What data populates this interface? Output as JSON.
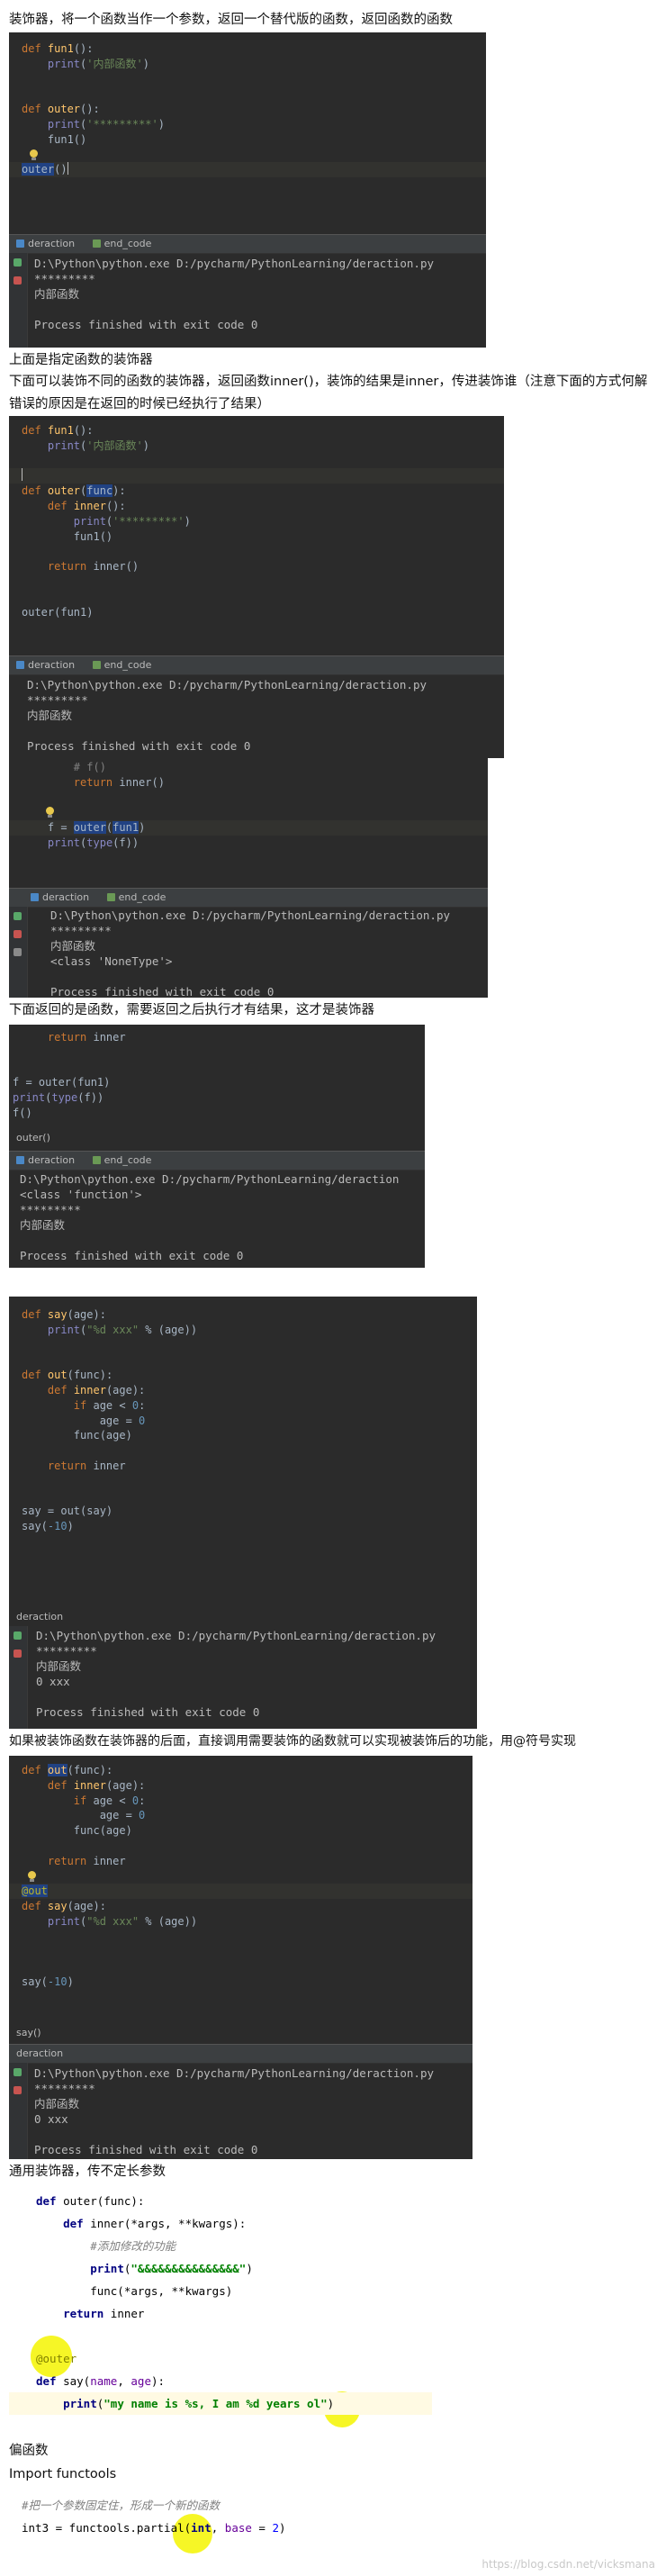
{
  "notes": {
    "n1": "装饰器，将一个函数当作一个参数，返回一个替代版的函数，返回函数的函数",
    "n2": "上面是指定函数的装饰器",
    "n3": "下面可以装饰不同的函数的装饰器，返回函数inner()，装饰的结果是inner，传进装饰谁（注意下面的方式何解错误的原因是在返回的时候已经执行了结果）",
    "n4": "下面返回的是函数，需要返回之后执行才有结果，这才是装饰器",
    "n5": "如果被装饰函数在装饰器的后面，直接调用需要装饰的函数就可以实现被装饰后的功能，用@符号实现",
    "n6": "通用装饰器，传不定长参数",
    "n7": "偏函数",
    "n8": "Import functools"
  },
  "tabs": {
    "run_tab": "deraction",
    "end_tab": "end_code",
    "outer_tab": "outer()",
    "say_tab": "say()"
  },
  "output": {
    "path": "D:\\Python\\python.exe D:/pycharm/PythonLearning/deraction.py",
    "path_cut": "D:\\Python\\python.exe D:/pycharm/PythonLearning/deraction",
    "stars": "*********",
    "inner_text": "内部函数",
    "finished": "Process finished with exit code 0",
    "none_type": "<class 'NoneType'>",
    "function_type": "<class 'function'>",
    "zero_xxx": "0 xxx"
  },
  "watermark": "https://blog.csdn.net/vicksmana"
}
